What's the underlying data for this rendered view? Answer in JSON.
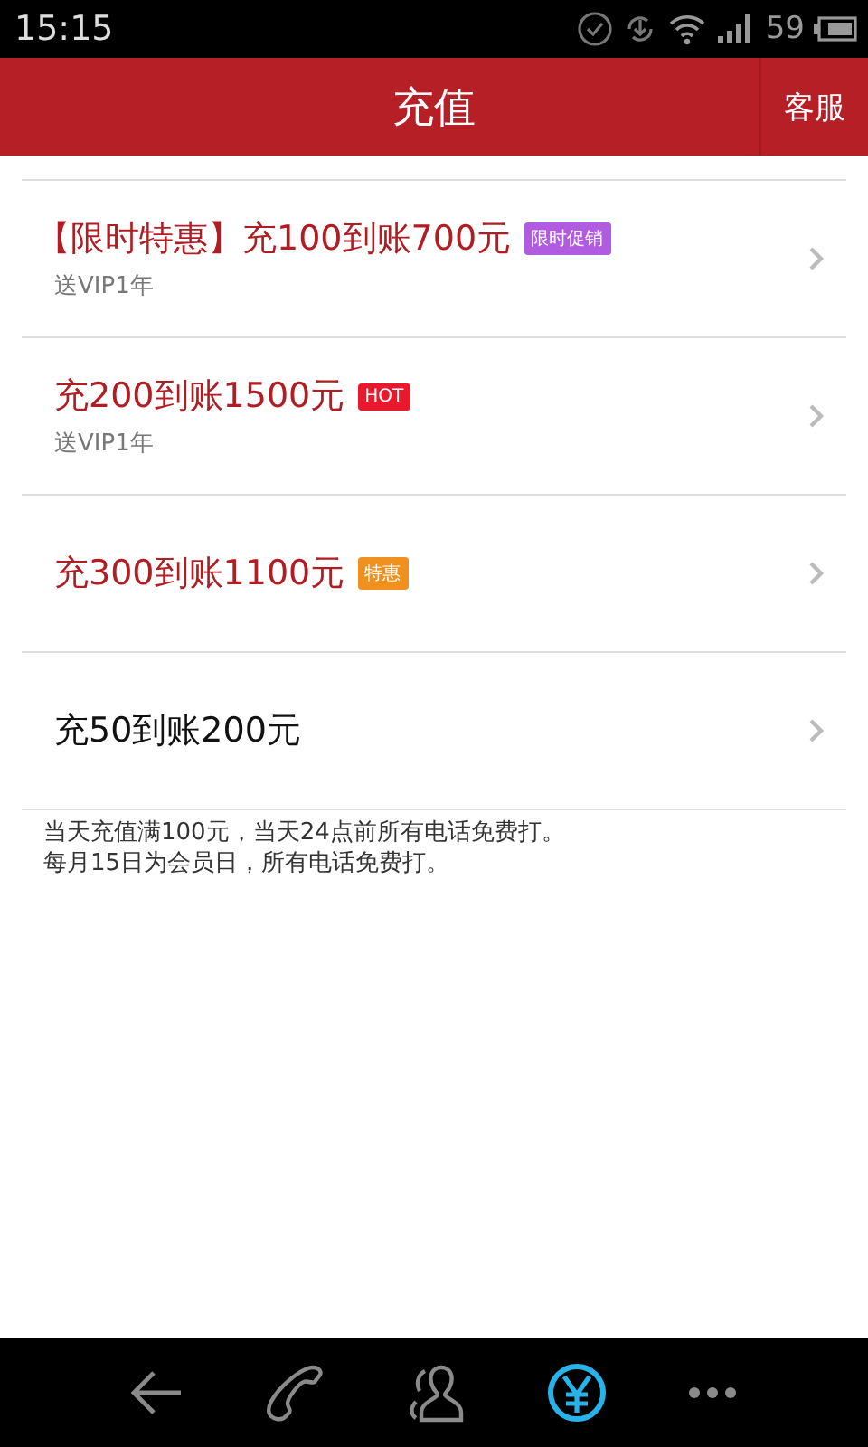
{
  "status_bar": {
    "time": "15:15",
    "battery": "59"
  },
  "header": {
    "title": "充值",
    "action": "客服"
  },
  "offers": [
    {
      "title": "【限时特惠】充100到账700元",
      "highlight": true,
      "badge": {
        "text": "限时促销",
        "color": "#b05be0"
      },
      "subtitle": "送VIP1年"
    },
    {
      "title": "充200到账1500元",
      "highlight": true,
      "badge": {
        "text": "HOT",
        "color": "#e8192c"
      },
      "subtitle": "送VIP1年"
    },
    {
      "title": "充300到账1100元",
      "highlight": true,
      "badge": {
        "text": "特惠",
        "color": "#f0901e"
      }
    },
    {
      "title": "充50到账200元",
      "highlight": false
    }
  ],
  "notes": [
    "当天充值满100元，当天24点前所有电话免费打。",
    "每月15日为会员日，所有电话免费打。"
  ],
  "nav": [
    {
      "kind": "back",
      "selected": false
    },
    {
      "kind": "phone",
      "selected": false
    },
    {
      "kind": "contacts",
      "selected": false
    },
    {
      "kind": "recharge",
      "selected": true
    },
    {
      "kind": "more",
      "selected": false
    }
  ]
}
